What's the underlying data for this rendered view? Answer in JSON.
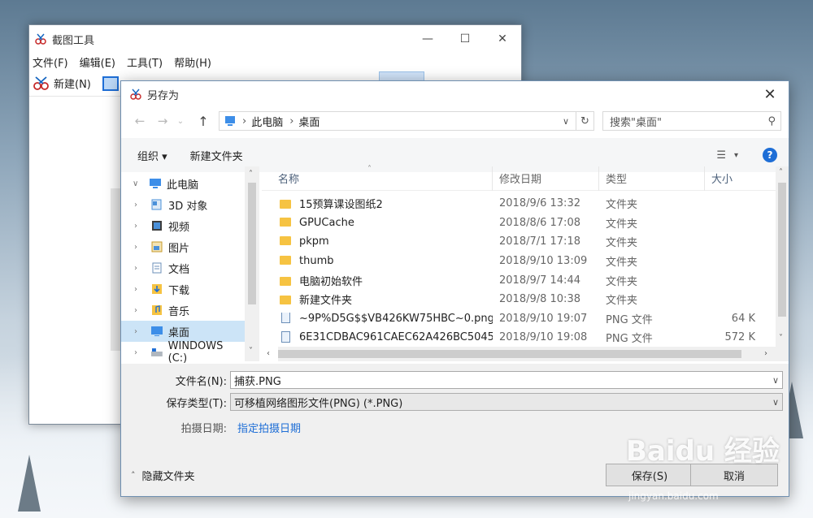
{
  "snip_window": {
    "title": "截图工具",
    "menu": [
      "文件(F)",
      "编辑(E)",
      "工具(T)",
      "帮助(H)"
    ],
    "new_label": "新建(N)"
  },
  "dialog": {
    "title": "另存为",
    "address": [
      "此电脑",
      "桌面"
    ],
    "search_placeholder": "搜索\"桌面\"",
    "toolbar": {
      "organize": "组织 ▾",
      "new_folder": "新建文件夹"
    },
    "tree": [
      {
        "label": "此电脑",
        "icon": "computer-icon"
      },
      {
        "label": "3D 对象",
        "icon": "cube-icon"
      },
      {
        "label": "视频",
        "icon": "video-icon"
      },
      {
        "label": "图片",
        "icon": "picture-icon"
      },
      {
        "label": "文档",
        "icon": "document-icon"
      },
      {
        "label": "下载",
        "icon": "download-icon"
      },
      {
        "label": "音乐",
        "icon": "music-icon"
      },
      {
        "label": "桌面",
        "icon": "desktop-icon"
      },
      {
        "label": "WINDOWS (C:)",
        "icon": "drive-icon"
      }
    ],
    "columns": {
      "name": "名称",
      "date": "修改日期",
      "type": "类型",
      "size": "大小"
    },
    "files": [
      {
        "name": "15预算课设图纸2",
        "date": "2018/9/6 13:32",
        "type": "文件夹",
        "size": "",
        "kind": "folder"
      },
      {
        "name": "GPUCache",
        "date": "2018/8/6 17:08",
        "type": "文件夹",
        "size": "",
        "kind": "folder"
      },
      {
        "name": "pkpm",
        "date": "2018/7/1 17:18",
        "type": "文件夹",
        "size": "",
        "kind": "folder"
      },
      {
        "name": "thumb",
        "date": "2018/9/10 13:09",
        "type": "文件夹",
        "size": "",
        "kind": "folder"
      },
      {
        "name": "电脑初始软件",
        "date": "2018/9/7 14:44",
        "type": "文件夹",
        "size": "",
        "kind": "folder"
      },
      {
        "name": "新建文件夹",
        "date": "2018/9/8 10:38",
        "type": "文件夹",
        "size": "",
        "kind": "folder"
      },
      {
        "name": "~9P%D5G$$VB426KW75HBC~0.png",
        "date": "2018/9/10 19:07",
        "type": "PNG 文件",
        "size": "64 K",
        "kind": "png"
      },
      {
        "name": "6E31CDBAC961CAEC62A426BC5045...",
        "date": "2018/9/10 19:08",
        "type": "PNG 文件",
        "size": "572 K",
        "kind": "png"
      }
    ],
    "form": {
      "filename_label": "文件名(N):",
      "filename_value": "捕获.PNG",
      "filetype_label": "保存类型(T):",
      "filetype_value": "可移植网络图形文件(PNG) (*.PNG)",
      "date_label": "拍摄日期:",
      "date_link": "指定拍摄日期"
    },
    "hide_folders": "隐藏文件夹",
    "save_button": "保存(S)",
    "cancel_button": "取消"
  },
  "watermark": {
    "main": "Baidu 经验",
    "sub": "jingyan.baidu.com"
  },
  "colors": {
    "accent": "#1e6ed6",
    "selection": "#cce4f7",
    "folder": "#f6c342"
  }
}
